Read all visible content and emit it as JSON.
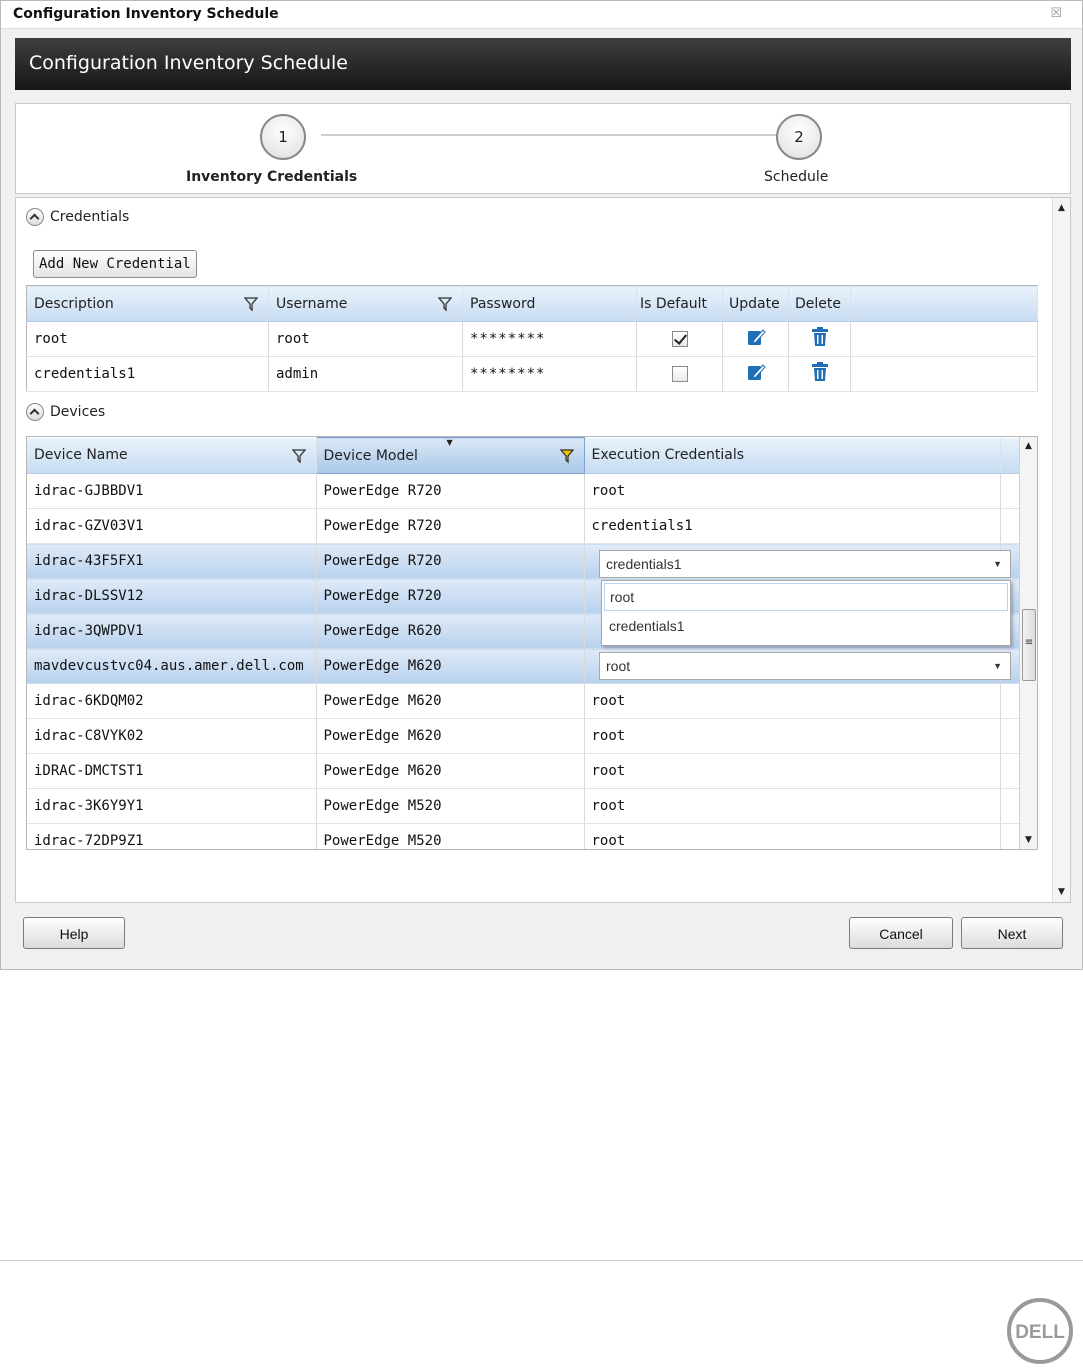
{
  "window": {
    "title": "Configuration Inventory Schedule",
    "close_glyph": "☒"
  },
  "banner": {
    "title": "Configuration Inventory Schedule"
  },
  "wizard": {
    "steps": [
      {
        "number": "1",
        "label": "Inventory Credentials",
        "active": true
      },
      {
        "number": "2",
        "label": "Schedule",
        "active": false
      }
    ]
  },
  "credentials": {
    "section_label": "Credentials",
    "add_button": "Add New Credential",
    "columns": [
      "Description",
      "Username",
      "Password",
      "Is Default",
      "Update",
      "Delete"
    ],
    "rows": [
      {
        "description": "root",
        "username": "root",
        "password": "********",
        "is_default": true
      },
      {
        "description": "credentials1",
        "username": "admin",
        "password": "********",
        "is_default": false
      }
    ]
  },
  "devices": {
    "section_label": "Devices",
    "columns": [
      "Device Name",
      "Device Model",
      "Execution Credentials"
    ],
    "rows": [
      {
        "name": "idrac-GJBBDV1",
        "model": "PowerEdge R720",
        "cred": "root"
      },
      {
        "name": "idrac-GZV03V1",
        "model": "PowerEdge R720",
        "cred": "credentials1"
      },
      {
        "name": "idrac-43F5FX1",
        "model": "PowerEdge R720",
        "cred": "credentials1"
      },
      {
        "name": "idrac-DLSSV12",
        "model": "PowerEdge R720",
        "cred": ""
      },
      {
        "name": "idrac-3QWPDV1",
        "model": "PowerEdge R620",
        "cred": ""
      },
      {
        "name": "mavdevcustvc04.aus.amer.dell.com",
        "model": "PowerEdge M620",
        "cred": "root"
      },
      {
        "name": "idrac-6KDQM02",
        "model": "PowerEdge M620",
        "cred": "root"
      },
      {
        "name": "idrac-C8VYK02",
        "model": "PowerEdge M620",
        "cred": "root"
      },
      {
        "name": "iDRAC-DMCTST1",
        "model": "PowerEdge M620",
        "cred": "root"
      },
      {
        "name": "idrac-3K6Y9Y1",
        "model": "PowerEdge M520",
        "cred": "root"
      },
      {
        "name": "idrac-72DP9Z1",
        "model": "PowerEdge M520",
        "cred": "root"
      }
    ],
    "combo_open": {
      "value": "credentials1",
      "options": [
        "root",
        "credentials1"
      ]
    },
    "combo_closed": {
      "value": "root"
    }
  },
  "footer": {
    "help": "Help",
    "cancel": "Cancel",
    "next": "Next"
  },
  "brand": {
    "logo_text": "DELL"
  },
  "colors": {
    "header_grad_top": "#e9f2fb",
    "header_grad_bottom": "#c7dcf2",
    "selected_row": "#b8d1ee",
    "icon_blue": "#1f6fb5",
    "filter_active": "#f2c200"
  }
}
